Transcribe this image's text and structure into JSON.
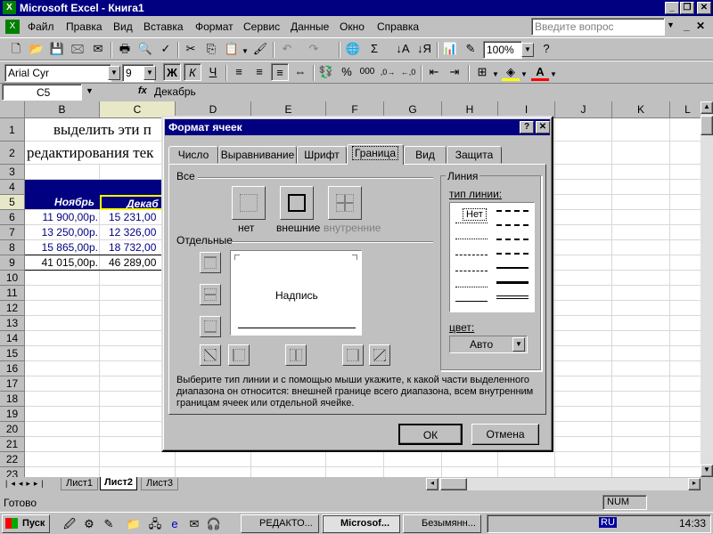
{
  "title_bar": {
    "title": "Microsoft Excel - Книга1"
  },
  "menu": {
    "items": [
      "Файл",
      "Правка",
      "Вид",
      "Вставка",
      "Формат",
      "Сервис",
      "Данные",
      "Окно",
      "Справка"
    ],
    "help_placeholder": "Введите вопрос"
  },
  "toolbar": {
    "zoom": "100%"
  },
  "format_bar": {
    "font": "Arial Cyr",
    "size": "9",
    "bold": "Ж",
    "italic": "К",
    "underline": "Ч"
  },
  "formula_bar": {
    "cell_ref": "C5",
    "fx": "fx",
    "value": "Декабрь"
  },
  "grid": {
    "columns": [
      "B",
      "C",
      "D",
      "E",
      "F",
      "G",
      "H",
      "I",
      "J",
      "K",
      "L"
    ],
    "rows": [
      "1",
      "2",
      "3",
      "4",
      "5",
      "6",
      "7",
      "8",
      "9",
      "10",
      "11",
      "12",
      "13",
      "14",
      "15",
      "16",
      "17",
      "18",
      "19",
      "20",
      "21",
      "22",
      "23"
    ],
    "row1_text": "выделить эти п",
    "row2_text": "редактирования тек",
    "header_b": "Ноябрь",
    "header_c": "Декаб",
    "data": [
      {
        "b": "11 900,00р.",
        "c": "15 231,00"
      },
      {
        "b": "13 250,00р.",
        "c": "12 326,00"
      },
      {
        "b": "15 865,00р.",
        "c": "18 732,00"
      },
      {
        "b": "41 015,00р.",
        "c": "46 289,00"
      }
    ]
  },
  "sheet_tabs": [
    "Лист1",
    "Лист2",
    "Лист3"
  ],
  "status": {
    "left": "Готово",
    "num": "NUM"
  },
  "taskbar": {
    "start": "Пуск",
    "tasks": [
      "РЕДАКТО...",
      "Microsof...",
      "Безымянн..."
    ],
    "lang": "RU",
    "time": "14:33"
  },
  "dialog": {
    "title": "Формат ячеек",
    "tabs": [
      "Число",
      "Выравнивание",
      "Шрифт",
      "Граница",
      "Вид",
      "Защита"
    ],
    "active_tab": "Граница",
    "all_group": "Все",
    "presets": [
      "нет",
      "внешние",
      "внутренние"
    ],
    "individual_group": "Отдельные",
    "preview_text": "Надпись",
    "line_group": "Линия",
    "line_type_label": "тип линии:",
    "none_style": "Нет",
    "color_label": "цвет:",
    "color_value": "Авто",
    "hint": "Выберите тип линии и с помощью мыши укажите, к какой части выделенного диапазона он относится: внешней границе всего диапазона, всем внутренним границам ячеек или отдельной ячейке.",
    "ok": "ОК",
    "cancel": "Отмена"
  }
}
